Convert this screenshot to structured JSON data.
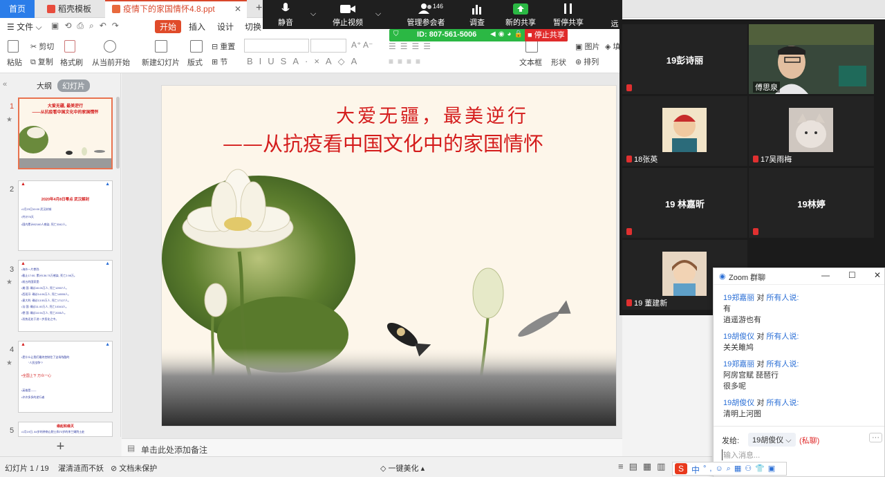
{
  "tabs": {
    "home": "首页",
    "template": "稻壳模板",
    "document": "疫情下的家国情怀4.8.ppt"
  },
  "menu": {
    "file": "文件",
    "start": "开始",
    "insert": "插入",
    "design": "设计",
    "switch": "切换"
  },
  "ribbon": {
    "paste": "粘贴",
    "cut": "剪切",
    "copy": "复制",
    "format_painter": "格式刷",
    "play_from_current": "从当前开始",
    "new_slide": "新建幻灯片",
    "layout": "版式",
    "reset": "重置",
    "section": "节",
    "textbox": "文本框",
    "shape": "形状",
    "arrange": "排列",
    "picture": "图片",
    "fill": "填充"
  },
  "left_panel": {
    "tab_outline": "大纲",
    "tab_slides": "幻灯片"
  },
  "thumbnails": [
    {
      "num": "1",
      "title": "大爱无疆, 最美逆行",
      "subtitle": "——从抗疫看中国文化中的家国情怀"
    },
    {
      "num": "2",
      "title": "2020年4月8日零点 武汉解封",
      "lines": [
        "•1月23日10:00 武汉封城",
        "•共计76天",
        "•国内累计82160人感染, 死亡3342人。"
      ]
    },
    {
      "num": "3",
      "lines": [
        "•海外一片惨烈:",
        "•截止17:00, 累计136.75万感染, 死亡2.98万。",
        "•前五的国家是:",
        "•美 国: 确诊40.05万人, 死亡12907人。",
        "•西班牙: 确诊14.06万人, 死亡14555人。",
        "•意大利: 确诊13.55万人, 死亡17127人。",
        "•法 国: 确诊11.00万人, 死亡10343人。",
        "•德 国: 确诊10.94万人, 死亡2035人。",
        "•形势还处于进一步恶化之中。"
      ]
    },
    {
      "num": "4",
      "lines": [
        "•是什么让我们最终控制住了这场残酷的",
        "“人民战争”?",
        "•全国上下 万众一心",
        "•英雄是——",
        "•许许多多的逆行者"
      ]
    },
    {
      "num": "5",
      "title": "缘起和缘灭",
      "lines": [
        "•1月19日, 84岁的钟南山院士和73岁的李兰娟院士赴"
      ]
    }
  ],
  "slide": {
    "title": "大爱无疆，最美逆行",
    "subtitle": "——从抗疫看中国文化中的家国情怀"
  },
  "notes": {
    "placeholder": "单击此处添加备注"
  },
  "status": {
    "slide_counter": "幻灯片 1 / 19",
    "theme": "濯清涟而不妖",
    "protection": "文档未保护",
    "beautify": "一键美化"
  },
  "zoom": {
    "toolbar": {
      "mute": "静音",
      "stop_video": "停止视频",
      "manage_participants": "管理参会者",
      "participant_count": "146",
      "poll": "调查",
      "new_share": "新的共享",
      "pause_share": "暂停共享",
      "more": "远"
    },
    "meeting_id": "ID: 807-561-5006",
    "stop_share": "停止共享",
    "gallery": [
      {
        "name": "19彭诗丽",
        "video": false
      },
      {
        "name": "傅思泉",
        "video": true
      },
      {
        "name": "18张英",
        "video": true
      },
      {
        "name": "17吴雨梅",
        "video": true
      },
      {
        "name": "19 林嘉昕",
        "video": false
      },
      {
        "name": "19林婷",
        "video": false
      },
      {
        "name": "19 董建新",
        "video": true
      }
    ]
  },
  "chat": {
    "title": "Zoom 群聊",
    "messages": [
      {
        "sender": "19郑嘉丽",
        "to_word": "对",
        "to": "所有人说:",
        "lines": [
          "有",
          "逍遥游也有"
        ]
      },
      {
        "sender": "19胡俊仪",
        "to_word": "对",
        "to": "所有人说:",
        "lines": [
          "关关雎鸠"
        ]
      },
      {
        "sender": "19郑嘉丽",
        "to_word": "对",
        "to": "所有人说:",
        "lines": [
          "阿房宫赋 琵琶行",
          "很多呢"
        ]
      },
      {
        "sender": "19胡俊仪",
        "to_word": "对",
        "to": "所有人说:",
        "lines": [
          "清明上河图"
        ]
      }
    ],
    "send_to_label": "发给:",
    "recipient": "19胡俊仪",
    "private": "(私聊)",
    "input_placeholder": "输入消息..."
  },
  "ime": {
    "label": "中"
  },
  "colors": {
    "accent_red": "#e04b2a",
    "zoom_green": "#2bb844",
    "chat_blue": "#2b6fd6",
    "title_red": "#d41c1c"
  }
}
